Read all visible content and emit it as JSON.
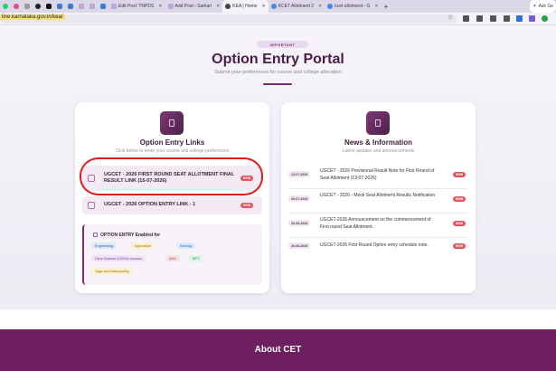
{
  "browser": {
    "tabs": [
      {
        "label": "",
        "icon": "whatsapp-icon"
      },
      {
        "label": "",
        "icon": "app-icon"
      },
      {
        "label": "",
        "icon": "app-icon"
      },
      {
        "label": "",
        "icon": "app-icon"
      },
      {
        "label": "",
        "icon": "app-icon"
      },
      {
        "label": "",
        "icon": "app-icon"
      },
      {
        "label": "",
        "icon": "app-icon"
      },
      {
        "label": "",
        "icon": "app-icon"
      },
      {
        "label": "",
        "icon": "app-icon"
      },
      {
        "label": "",
        "icon": "app-icon"
      },
      {
        "label": "Edit Post 'TNPDS",
        "icon": "wordpress-icon"
      },
      {
        "label": "Add Post ‹ Sarkari",
        "icon": "wordpress-icon"
      },
      {
        "label": "KEA | Home",
        "icon": "globe-icon"
      },
      {
        "label": "KCET Allotment 2",
        "icon": "globe-icon"
      },
      {
        "label": "kcet allotment - G",
        "icon": "google-icon"
      },
      {
        "label": "Ask Ge",
        "icon": "sparkle-icon"
      }
    ],
    "url": "line.karnataka.gov.in/kea/"
  },
  "hero": {
    "badge": "IMPORTANT",
    "title": "Option Entry Portal",
    "subtitle": "Submit your preferences for course and college allocation"
  },
  "links_card": {
    "title": "Option Entry Links",
    "subtitle": "Click below to enter your course and college preferences",
    "links": [
      {
        "label": "UGCET - 2026 FIRST ROUND SEAT ALLOTMENT FINAL RESULT LINK (15-07-2026)",
        "badge": "NEW"
      },
      {
        "label": "UGCET - 2026 OPTION ENTRY LINK - 1",
        "badge": "NEW"
      }
    ],
    "enabled_title": "OPTION ENTRY Enabled for",
    "courses": [
      "Engineering",
      "Agriculture",
      "Nursing",
      "Farm Science & BVSc courses",
      "AHS",
      "BPT",
      "Yoga and Naturopathy"
    ]
  },
  "news_card": {
    "title": "News & Information",
    "subtitle": "Latest updates and announcements",
    "items": [
      {
        "date": "13-07-2026",
        "text": "UGCET - 2026 Provisional Result Note for First Round of Seat Allotment (13-07-2026)",
        "badge": "NEW"
      },
      {
        "date": "06-07-2026",
        "text": "UGCET - 2026 - Mock Seat Allotment Results Notification",
        "badge": "NEW"
      },
      {
        "date": "26-06-2026",
        "text": "UGCET-2026 Announcement on the commencement of First round Seat Allotment.",
        "badge": "NEW"
      },
      {
        "date": "26-06-2026",
        "text": "UGCET-2026 First Round Option entry schedule note.",
        "badge": "NEW"
      }
    ]
  },
  "footer": {
    "title": "About CET"
  },
  "colors": {
    "brand": "#6d1f5f",
    "new_badge": "#e0565f",
    "annotation": "#e01b1b"
  }
}
